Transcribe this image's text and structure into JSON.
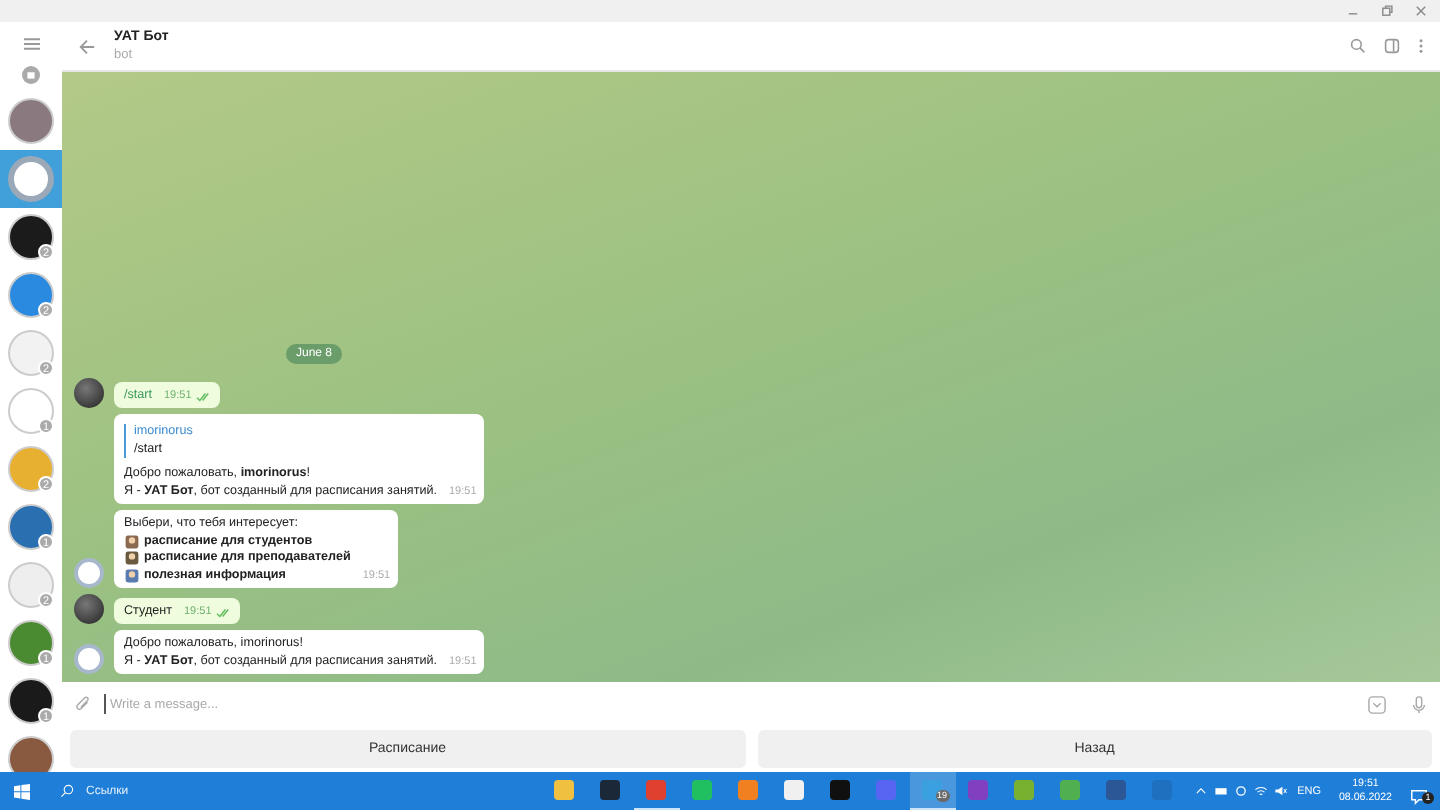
{
  "header": {
    "title": "УАТ Бот",
    "subtitle": "bot"
  },
  "sidebar": {
    "chats": [
      {
        "color": "#8a7a80",
        "selected": false
      },
      {
        "color": "#ffffff",
        "selected": true
      },
      {
        "color": "#1b1b1b",
        "selected": false,
        "badge": "2"
      },
      {
        "color": "#2a8ae0",
        "selected": false,
        "badge": "2"
      },
      {
        "color": "#f2f2f2",
        "selected": false,
        "badge": "2"
      },
      {
        "color": "#ffffff",
        "selected": false,
        "badge": "1"
      },
      {
        "color": "#e8b030",
        "selected": false,
        "badge": "2"
      },
      {
        "color": "#2a6fb0",
        "selected": false,
        "badge": "1"
      },
      {
        "color": "#eeeeee",
        "selected": false,
        "badge": "2"
      },
      {
        "color": "#4a8a30",
        "selected": false,
        "badge": "1"
      },
      {
        "color": "#1a1a1a",
        "selected": false,
        "badge": "1"
      },
      {
        "color": "#8a5a40",
        "selected": false
      }
    ]
  },
  "messages": [
    {
      "kind": "date",
      "text": "June 8"
    },
    {
      "kind": "outgoing",
      "avatar": true,
      "text": "/start",
      "time": "19:51",
      "read": true
    },
    {
      "kind": "incoming",
      "avatar": false,
      "reply_author": "imorinorus",
      "reply_text": "/start",
      "lines": [
        "Добро пожаловать, **imorinorus**!",
        "Я - **УАТ Бот**, бот созданный для расписания занятий."
      ],
      "time": "19:51"
    },
    {
      "kind": "incoming",
      "avatar": true,
      "lines": [
        "Выбери, что тебя интересует:"
      ],
      "options": [
        "расписание для студентов",
        "расписание для преподавателей",
        "полезная информация"
      ],
      "time": "19:51"
    },
    {
      "kind": "outgoing",
      "avatar": true,
      "text": "Студент",
      "time": "19:51",
      "read": true
    },
    {
      "kind": "incoming",
      "avatar": true,
      "lines": [
        "Добро пожаловать, imorinorus!",
        "Я - **УАТ Бот**, бот созданный для расписания занятий."
      ],
      "time": "19:51"
    }
  ],
  "composer": {
    "placeholder": "Write a message..."
  },
  "keyboard": [
    "Расписание",
    "Назад"
  ],
  "taskbar": {
    "search_label": "Ссылки",
    "apps": [
      {
        "color": "#f0c040",
        "selected": false,
        "open": false
      },
      {
        "color": "#1b2838",
        "selected": false,
        "open": false
      },
      {
        "color": "#e04030",
        "selected": false,
        "open": true
      },
      {
        "color": "#20c060",
        "selected": false,
        "open": false
      },
      {
        "color": "#f08020",
        "selected": false,
        "open": false
      },
      {
        "color": "#f0f0f0",
        "selected": false,
        "open": false
      },
      {
        "color": "#101010",
        "selected": false,
        "open": false
      },
      {
        "color": "#5865f2",
        "selected": false,
        "open": false
      },
      {
        "color": "#3aa0e0",
        "selected": true,
        "open": true,
        "badge": "19"
      },
      {
        "color": "#8040c0",
        "selected": false,
        "open": false
      },
      {
        "color": "#78b030",
        "selected": false,
        "open": false
      },
      {
        "color": "#50b050",
        "selected": false,
        "open": false
      },
      {
        "color": "#2b5797",
        "selected": false,
        "open": false
      },
      {
        "color": "#2070c0",
        "selected": false,
        "open": false
      }
    ],
    "language": "ENG",
    "time": "19:51",
    "date": "08.06.2022",
    "notifications": "1"
  }
}
